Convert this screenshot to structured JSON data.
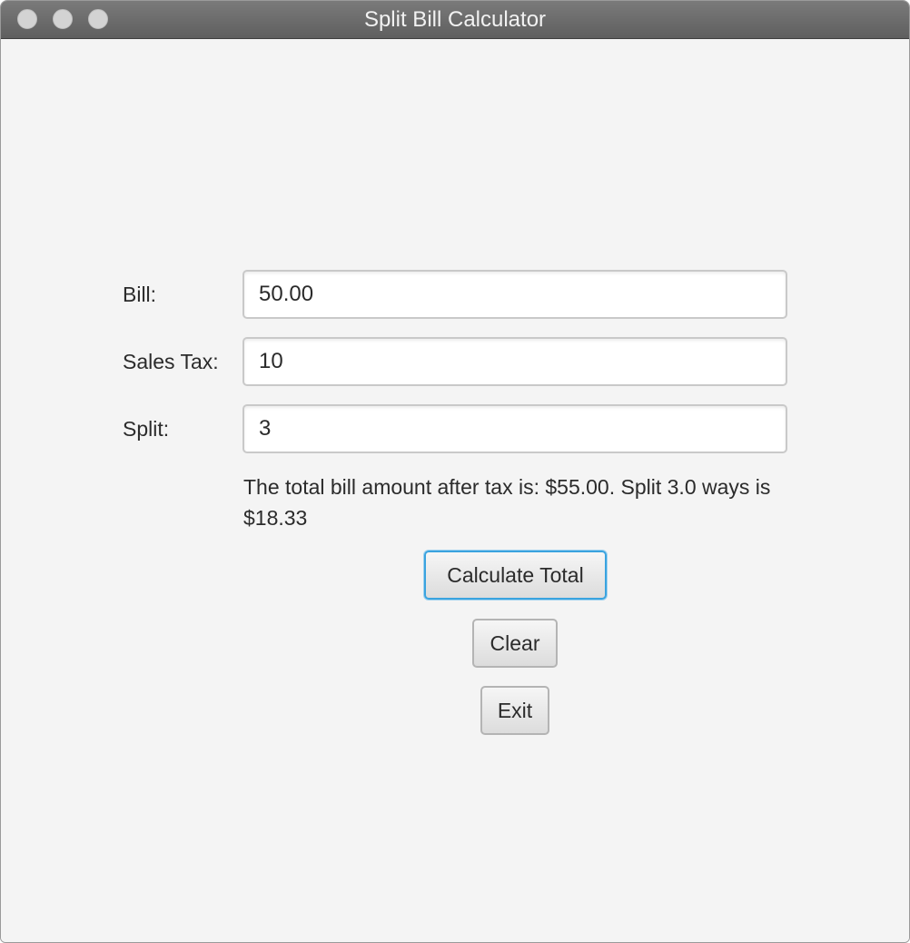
{
  "window": {
    "title": "Split Bill Calculator"
  },
  "form": {
    "bill": {
      "label": "Bill:",
      "value": "50.00"
    },
    "sales_tax": {
      "label": "Sales Tax:",
      "value": "10"
    },
    "split": {
      "label": "Split:",
      "value": "3"
    }
  },
  "result": {
    "text": "The total bill amount after tax is: $55.00. Split 3.0 ways is $18.33"
  },
  "buttons": {
    "calculate_label": "Calculate Total",
    "clear_label": "Clear",
    "exit_label": "Exit"
  },
  "colors": {
    "focus_accent": "#3aa3df",
    "background": "#f4f4f4"
  }
}
